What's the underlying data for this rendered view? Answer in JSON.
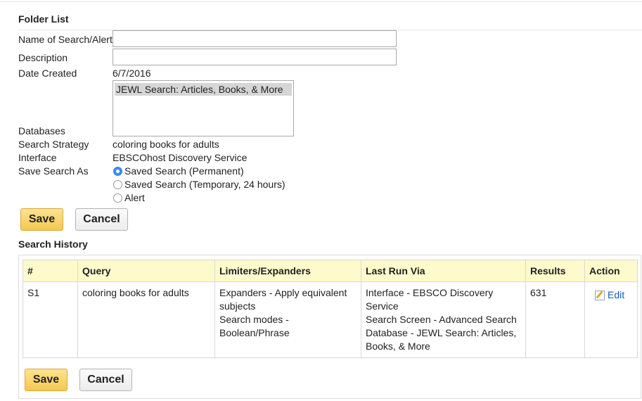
{
  "folder": {
    "title": "Folder List"
  },
  "form": {
    "name_label": "Name of Search/Alert",
    "name_value": "",
    "description_label": "Description",
    "description_value": "",
    "date_created_label": "Date Created",
    "date_created_value": "6/7/2016",
    "databases_label": "Databases",
    "databases_options": [
      "JEWL Search: Articles, Books, & More"
    ],
    "search_strategy_label": "Search Strategy",
    "search_strategy_value": "coloring books for adults",
    "interface_label": "Interface",
    "interface_value": "EBSCOhost Discovery Service",
    "save_as_label": "Save Search As",
    "save_as_options": [
      {
        "label": "Saved Search (Permanent)",
        "checked": true
      },
      {
        "label": "Saved Search (Temporary, 24 hours)",
        "checked": false
      },
      {
        "label": "Alert",
        "checked": false
      }
    ],
    "save_label": "Save",
    "cancel_label": "Cancel"
  },
  "history": {
    "title": "Search History",
    "columns": [
      "#",
      "Query",
      "Limiters/Expanders",
      "Last Run Via",
      "Results",
      "Action"
    ],
    "rows": [
      {
        "id": "S1",
        "query": "coloring books for adults",
        "limiters": [
          "Expanders - Apply equivalent",
          "subjects",
          "Search modes -",
          "Boolean/Phrase"
        ],
        "last_run": [
          "Interface - EBSCO Discovery",
          "Service",
          "Search Screen - Advanced Search",
          "Database - JEWL Search: Articles,",
          "Books, & More"
        ],
        "results": "631",
        "action_label": "Edit"
      }
    ],
    "save_label": "Save",
    "cancel_label": "Cancel"
  },
  "colors": {
    "header_bg": "#fdfacb",
    "save_button": "#f5c84f",
    "link": "#1a56b8",
    "radio_checked": "#3a8ef0"
  },
  "icons": {
    "edit": "edit-icon"
  }
}
